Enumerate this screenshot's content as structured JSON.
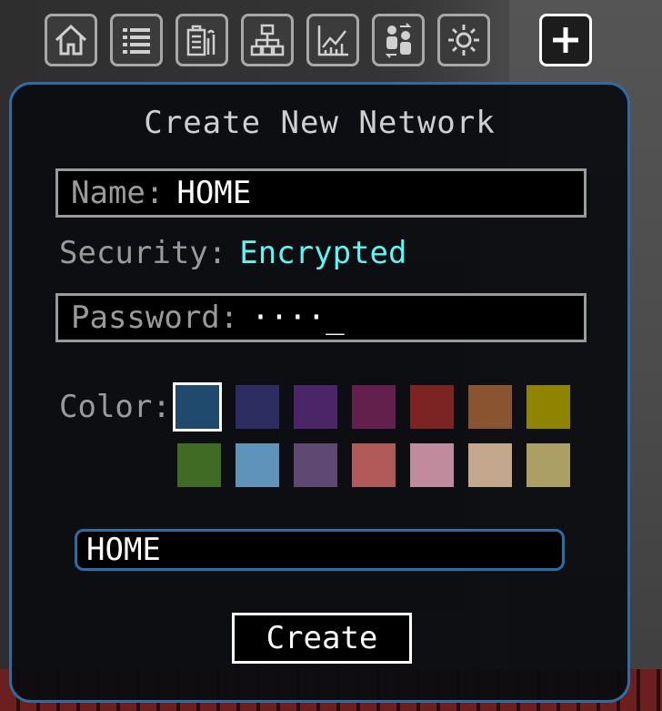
{
  "toolbar": {
    "tabs": [
      {
        "icon": "home-icon"
      },
      {
        "icon": "list-icon"
      },
      {
        "icon": "device-battery-icon"
      },
      {
        "icon": "network-hierarchy-icon"
      },
      {
        "icon": "chart-icon"
      },
      {
        "icon": "users-transfer-icon"
      },
      {
        "icon": "gear-icon"
      },
      {
        "icon": "plus-icon"
      }
    ]
  },
  "dialog": {
    "title": "Create New Network",
    "name_label": "Name:",
    "name_value": "HOME",
    "security_label": "Security:",
    "security_value": "Encrypted",
    "password_label": "Password:",
    "password_value": "····_",
    "color_label": "Color:",
    "colors": [
      "#1f4a6e",
      "#2d2d62",
      "#4a2568",
      "#64204c",
      "#7c2424",
      "#8a5430",
      "#8f8400",
      "#3f6b24",
      "#5f93ba",
      "#5f4872",
      "#b15a5a",
      "#c08b9c",
      "#c4a88e",
      "#ab9f64"
    ],
    "selected_color_index": 0,
    "preview_name": "HOME",
    "create_label": "Create"
  }
}
